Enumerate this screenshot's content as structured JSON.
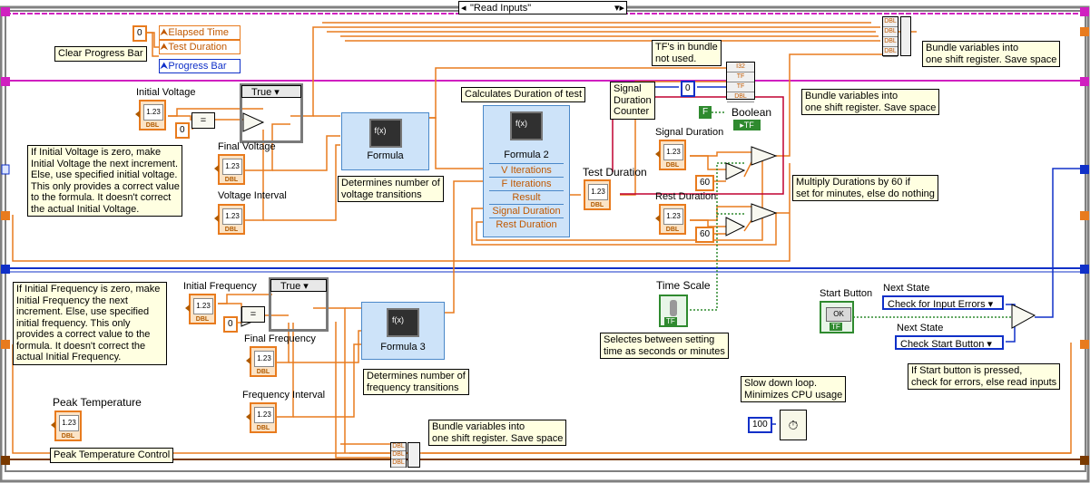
{
  "case_selector": {
    "value": "\"Read Inputs\""
  },
  "refs": {
    "elapsed_time": "Elapsed Time",
    "test_duration": "Test Duration",
    "progress_bar": "Progress Bar"
  },
  "constants": {
    "zero_top": "0",
    "zero_voltage": "0",
    "zero_freq": "0",
    "sixty_signal": "60",
    "sixty_rest": "60",
    "zero_counter": "0",
    "hundred": "100",
    "false_const": "F"
  },
  "notes": {
    "clear_progress": "Clear Progress Bar",
    "voltage_zero": "If Initial Voltage is zero, make\nInitial Voltage the next increment.\nElse, use specified initial voltage.\nThis only provides a correct value\nto the formula. It doesn't correct\nthe actual Initial Voltage.",
    "voltage_transitions": "Determines number of\nvoltage transitions",
    "duration_of_test": "Calculates Duration of test",
    "signal_counter": "Signal\nDuration\nCounter",
    "tf_bundle": "TF's in bundle\nnot used.",
    "bundle_top_right": "Bundle variables into\none shift register. Save space",
    "bundle_middle": "Bundle variables into\none shift register. Save space",
    "multiply_60": "Multiply Durations by 60 if\nset for minutes, else do nothing",
    "frequency_zero": "If Initial Frequency is zero, make\nInitial Frequency the next\nincrement. Else, use specified\ninitial frequency. This only\nprovides a correct value to the\nformula. It doesn't correct the\nactual Initial Frequency.",
    "frequency_transitions": "Determines number of\nfrequency transitions",
    "time_scale_note": "Selectes between setting\ntime as seconds or minutes",
    "slow_down": "Slow down loop.\nMinimizes CPU usage",
    "start_note": "If Start button is pressed,\ncheck for errors, else read inputs",
    "bundle_bottom": "Bundle variables into\none shift register. Save space",
    "peak_temp_control": "Peak Temperature Control"
  },
  "labels": {
    "initial_voltage": "Initial Voltage",
    "final_voltage": "Final Voltage",
    "voltage_interval": "Voltage Interval",
    "initial_frequency": "Initial Frequency",
    "final_frequency": "Final Frequency",
    "frequency_interval": "Frequency Interval",
    "peak_temperature": "Peak Temperature",
    "test_duration": "Test Duration",
    "signal_duration": "Signal Duration",
    "rest_duration": "Rest Duration",
    "boolean": "Boolean",
    "time_scale": "Time Scale",
    "start_button": "Start Button",
    "next_state_1": "Next State",
    "next_state_2": "Next State"
  },
  "case_structures": {
    "voltage_case": "True",
    "frequency_case": "True"
  },
  "formula_nodes": {
    "formula1": {
      "title": "Formula"
    },
    "formula2": {
      "title": "Formula 2",
      "rows": [
        "V Iterations",
        "F Iterations",
        "Result",
        "Signal Duration",
        "Rest Duration"
      ]
    },
    "formula3": {
      "title": "Formula 3"
    }
  },
  "enums": {
    "next_state_1": "Check for Input Errors",
    "next_state_2": "Check Start Button"
  },
  "control_face": "1.23",
  "control_type": "DBL",
  "indicator_tf": "TF",
  "start_button_face": "OK",
  "colors": {
    "orange_wire": "#e87b1e",
    "blue_wire": "#1030c8",
    "pink_wire": "#d020c0",
    "green_wire": "#2f8a2f",
    "note_bg": "#ffffe1",
    "formula_bg": "#cde3f9"
  }
}
